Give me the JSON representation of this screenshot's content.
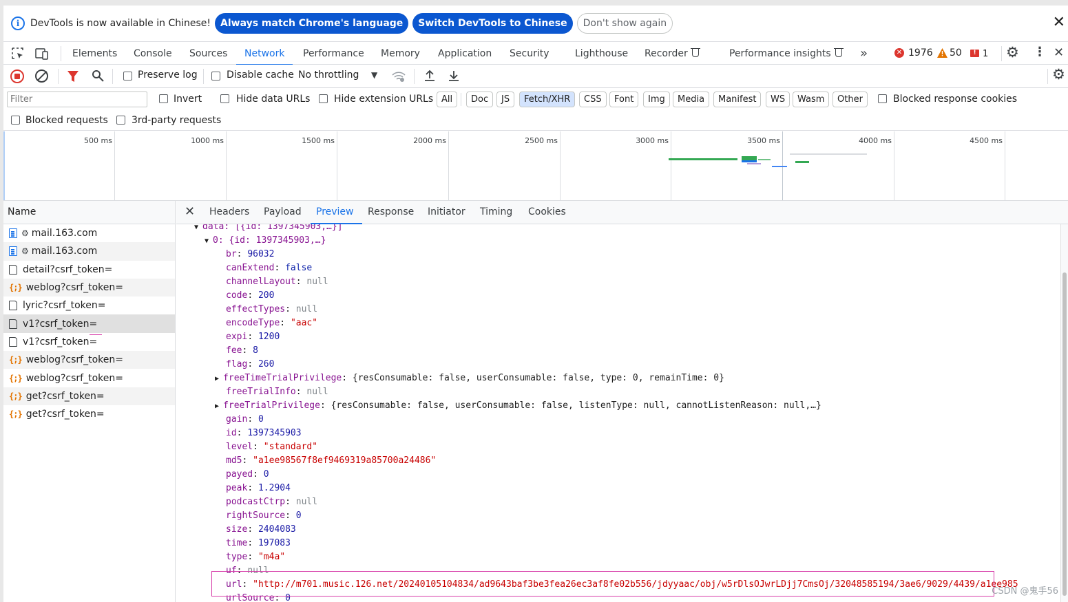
{
  "infobar": {
    "message": "DevTools is now available in Chinese!",
    "btn_match": "Always match Chrome's language",
    "btn_switch": "Switch DevTools to Chinese",
    "btn_dismiss": "Don't show again",
    "close": "✕"
  },
  "tabs": {
    "elements": "Elements",
    "console": "Console",
    "sources": "Sources",
    "network": "Network",
    "performance": "Performance",
    "memory": "Memory",
    "application": "Application",
    "security": "Security",
    "lighthouse": "Lighthouse",
    "recorder": "Recorder",
    "insights": "Performance insights",
    "more": "»",
    "errors": "1976",
    "warnings": "50",
    "issues": "1"
  },
  "toolbar": {
    "preserve_log": "Preserve log",
    "disable_cache": "Disable cache",
    "throttling": "No throttling"
  },
  "filter": {
    "placeholder": "Filter",
    "invert": "Invert",
    "hide_data_urls": "Hide data URLs",
    "hide_ext_urls": "Hide extension URLs",
    "types": [
      "All",
      "Doc",
      "JS",
      "Fetch/XHR",
      "CSS",
      "Font",
      "Img",
      "Media",
      "Manifest",
      "WS",
      "Wasm",
      "Other"
    ],
    "blocked_cookies": "Blocked response cookies",
    "blocked_requests": "Blocked requests",
    "third_party": "3rd-party requests"
  },
  "overview": {
    "ticks": [
      "500 ms",
      "1000 ms",
      "1500 ms",
      "2000 ms",
      "2500 ms",
      "3000 ms",
      "3500 ms",
      "4000 ms",
      "4500 ms"
    ]
  },
  "requests": {
    "header": "Name",
    "rows": [
      {
        "name": "mail.163.com",
        "type": "doc"
      },
      {
        "name": "mail.163.com",
        "type": "doc"
      },
      {
        "name": "detail?csrf_token=",
        "type": "file"
      },
      {
        "name": "weblog?csrf_token=",
        "type": "xhr"
      },
      {
        "name": "lyric?csrf_token=",
        "type": "file"
      },
      {
        "name": "v1?csrf_token=",
        "type": "file"
      },
      {
        "name": "v1?csrf_token=",
        "type": "file"
      },
      {
        "name": "weblog?csrf_token=",
        "type": "xhr"
      },
      {
        "name": "weblog?csrf_token=",
        "type": "xhr"
      },
      {
        "name": "get?csrf_token=",
        "type": "xhr"
      },
      {
        "name": "get?csrf_token=",
        "type": "xhr"
      }
    ]
  },
  "detail": {
    "tabs": [
      "Headers",
      "Payload",
      "Preview",
      "Response",
      "Initiator",
      "Timing",
      "Cookies"
    ]
  },
  "preview": {
    "data_line": "data: [{id: 1397345903,…}]",
    "item_line": "0: {id: 1397345903,…}",
    "fields": [
      {
        "key": "br",
        "val": "96032",
        "kind": "num"
      },
      {
        "key": "canExtend",
        "val": "false",
        "kind": "bool"
      },
      {
        "key": "channelLayout",
        "val": "null",
        "kind": "nul"
      },
      {
        "key": "code",
        "val": "200",
        "kind": "num"
      },
      {
        "key": "effectTypes",
        "val": "null",
        "kind": "nul"
      },
      {
        "key": "encodeType",
        "val": "\"aac\"",
        "kind": "str"
      },
      {
        "key": "expi",
        "val": "1200",
        "kind": "num"
      },
      {
        "key": "fee",
        "val": "8",
        "kind": "num"
      },
      {
        "key": "flag",
        "val": "260",
        "kind": "num"
      },
      {
        "key": "freeTimeTrialPrivilege",
        "val": "{resConsumable: false, userConsumable: false, type: 0, remainTime: 0}",
        "kind": "obj"
      },
      {
        "key": "freeTrialInfo",
        "val": "null",
        "kind": "nul"
      },
      {
        "key": "freeTrialPrivilege",
        "val": "{resConsumable: false, userConsumable: false, listenType: null, cannotListenReason: null,…}",
        "kind": "obj"
      },
      {
        "key": "gain",
        "val": "0",
        "kind": "num"
      },
      {
        "key": "id",
        "val": "1397345903",
        "kind": "num"
      },
      {
        "key": "level",
        "val": "\"standard\"",
        "kind": "str"
      },
      {
        "key": "md5",
        "val": "\"a1ee98567f8ef9469319a85700a24486\"",
        "kind": "str"
      },
      {
        "key": "payed",
        "val": "0",
        "kind": "num"
      },
      {
        "key": "peak",
        "val": "1.2904",
        "kind": "num"
      },
      {
        "key": "podcastCtrp",
        "val": "null",
        "kind": "nul"
      },
      {
        "key": "rightSource",
        "val": "0",
        "kind": "num"
      },
      {
        "key": "size",
        "val": "2404083",
        "kind": "num"
      },
      {
        "key": "time",
        "val": "197083",
        "kind": "num"
      },
      {
        "key": "type",
        "val": "\"m4a\"",
        "kind": "str"
      },
      {
        "key": "uf",
        "val": "null",
        "kind": "nul"
      },
      {
        "key": "url",
        "val": "\"http://m701.music.126.net/20240105104834/ad9643baf3be3fea26ec3af8fe02b556/jdyyaac/obj/w5rDlsOJwrLDjj7CmsOj/32048585194/3ae6/9029/4439/a1ee985",
        "kind": "str"
      },
      {
        "key": "urlSource",
        "val": "0",
        "kind": "num"
      }
    ]
  },
  "watermark": "CSDN @鬼手56"
}
